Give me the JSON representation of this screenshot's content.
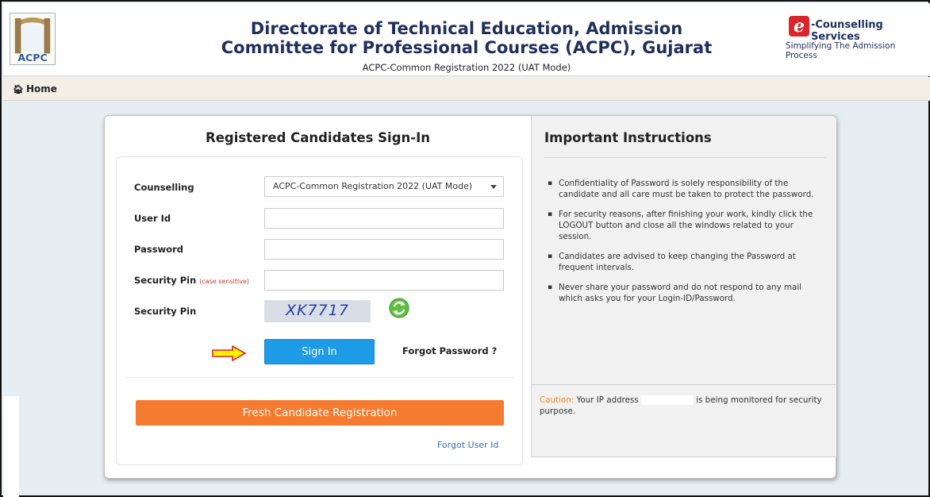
{
  "header": {
    "logo_text": "ACPC",
    "title_line1": "Directorate of Technical Education, Admission",
    "title_line2": "Committee for Professional Courses (ACPC), Gujarat",
    "subtitle": "ACPC-Common Registration 2022 (UAT Mode)",
    "ecs_letter": "e",
    "ecs_name": "-Counselling Services",
    "ecs_tagline": "Simplifying The Admission Process"
  },
  "nav": {
    "home_icon": "home-icon",
    "home_label": "Home"
  },
  "signin": {
    "title": "Registered Candidates Sign-In",
    "counselling_label": "Counselling",
    "counselling_value": "ACPC-Common Registration 2022 (UAT Mode)",
    "userid_label": "User Id",
    "userid_value": "",
    "password_label": "Password",
    "password_value": "",
    "pin_label": "Security Pin",
    "pin_note": "(case sensitive)",
    "pin_value": "",
    "captcha_label": "Security Pin",
    "captcha_text": "XK7717",
    "signin_button": "Sign In",
    "forgot_password": "Forgot Password ?",
    "fresh_registration": "Fresh Candidate Registration",
    "forgot_userid": "Forgot User Id"
  },
  "instructions": {
    "title": "Important Instructions",
    "items": [
      "Confidentiality of Password is solely responsibility of the candidate and all care must be taken to protect the password.",
      "For security reasons, after finishing your work, kindly click the LOGOUT button and close all the windows related to your session.",
      "Candidates are advised to keep changing the Password at frequent intervals.",
      "Never share your password and do not respond to any mail which asks you for your Login-ID/Password."
    ],
    "caution_label": "Caution:",
    "caution_pre": "Your IP address",
    "caution_post": "is being monitored for security purpose."
  },
  "colors": {
    "title_blue": "#1f2f5c",
    "signin_button": "#1e9be6",
    "fresh_button": "#f47b2f",
    "caution": "#f28b2f",
    "page_bg": "#e6eef4"
  }
}
